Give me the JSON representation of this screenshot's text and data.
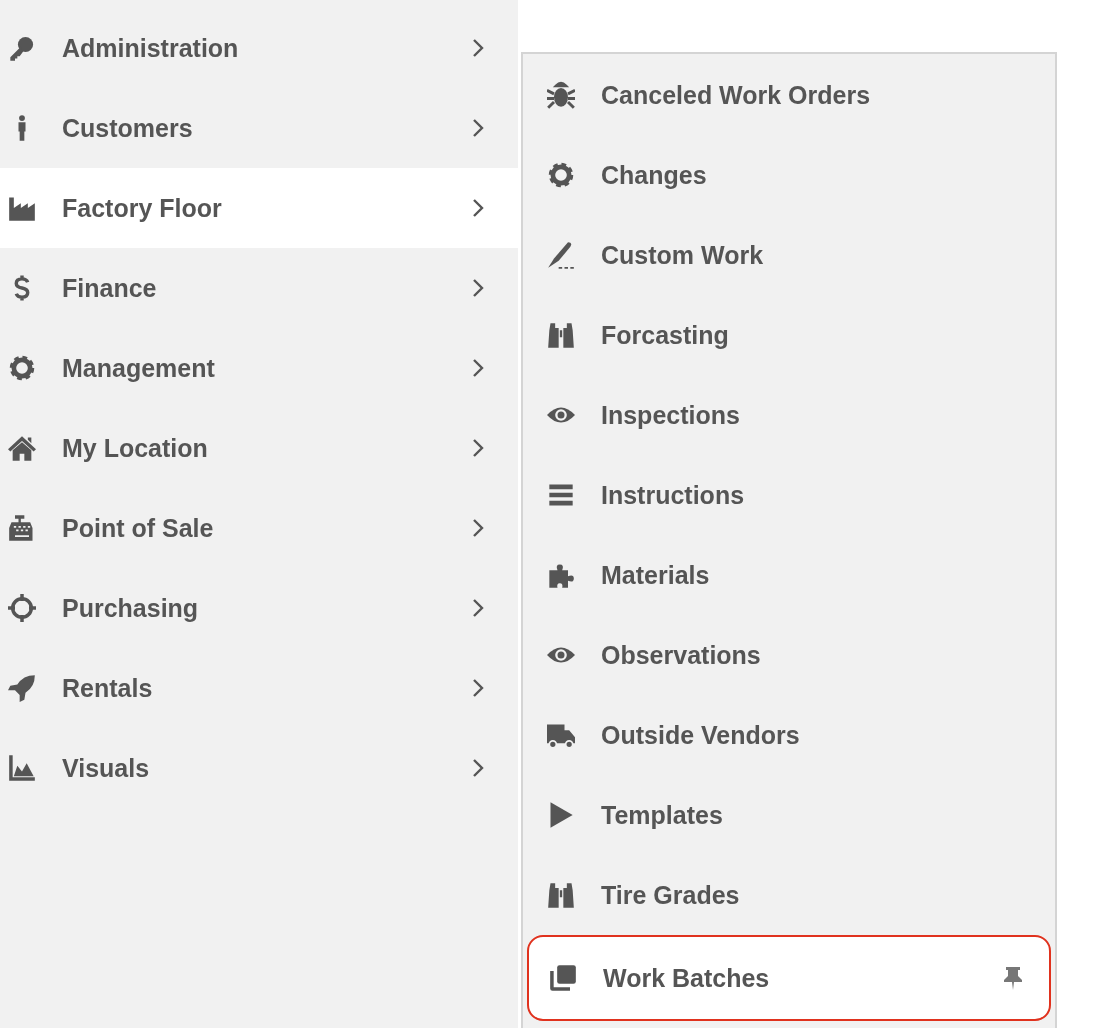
{
  "sidebar": {
    "items": [
      {
        "label": "Administration",
        "kind": "key",
        "selected": false
      },
      {
        "label": "Customers",
        "kind": "person",
        "selected": false
      },
      {
        "label": "Factory Floor",
        "kind": "factory",
        "selected": true
      },
      {
        "label": "Finance",
        "kind": "dollar",
        "selected": false
      },
      {
        "label": "Management",
        "kind": "gear",
        "selected": false
      },
      {
        "label": "My Location",
        "kind": "home",
        "selected": false
      },
      {
        "label": "Point of Sale",
        "kind": "register",
        "selected": false
      },
      {
        "label": "Purchasing",
        "kind": "crosshair",
        "selected": false
      },
      {
        "label": "Rentals",
        "kind": "rocket",
        "selected": false
      },
      {
        "label": "Visuals",
        "kind": "chart",
        "selected": false
      }
    ]
  },
  "submenu": {
    "items": [
      {
        "label": "Canceled Work Orders",
        "kind": "bug",
        "selected": false,
        "pinned": false
      },
      {
        "label": "Changes",
        "kind": "gear",
        "selected": false,
        "pinned": false
      },
      {
        "label": "Custom Work",
        "kind": "scalpel",
        "selected": false,
        "pinned": false
      },
      {
        "label": "Forcasting",
        "kind": "binoculars",
        "selected": false,
        "pinned": false
      },
      {
        "label": "Inspections",
        "kind": "eye",
        "selected": false,
        "pinned": false
      },
      {
        "label": "Instructions",
        "kind": "lines",
        "selected": false,
        "pinned": false
      },
      {
        "label": "Materials",
        "kind": "puzzle",
        "selected": false,
        "pinned": false
      },
      {
        "label": "Observations",
        "kind": "eye",
        "selected": false,
        "pinned": false
      },
      {
        "label": "Outside Vendors",
        "kind": "truck",
        "selected": false,
        "pinned": false
      },
      {
        "label": "Templates",
        "kind": "play",
        "selected": false,
        "pinned": false
      },
      {
        "label": "Tire Grades",
        "kind": "binoculars",
        "selected": false,
        "pinned": false
      },
      {
        "label": "Work Batches",
        "kind": "copy",
        "selected": true,
        "pinned": true
      }
    ]
  }
}
